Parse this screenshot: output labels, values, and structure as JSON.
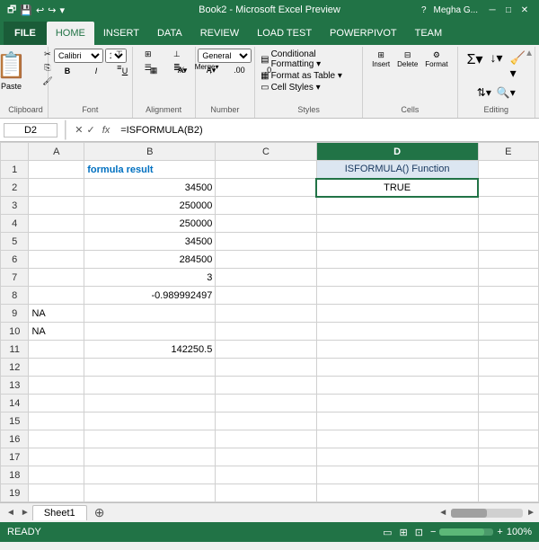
{
  "titleBar": {
    "title": "Book2 - Microsoft Excel Preview",
    "controls": [
      "–",
      "□",
      "×"
    ]
  },
  "ribbonTabs": {
    "file": "FILE",
    "tabs": [
      "HOME",
      "INSERT",
      "DATA",
      "REVIEW",
      "LOAD TEST",
      "POWERPIVOT",
      "TEAM"
    ],
    "activeTab": "HOME",
    "user": "Megha G..."
  },
  "ribbonGroups": {
    "clipboard": {
      "label": "Clipboard",
      "paste": "Paste"
    },
    "font": {
      "label": "Font"
    },
    "alignment": {
      "label": "Alignment"
    },
    "number": {
      "label": "Number"
    },
    "styles": {
      "label": "Styles",
      "items": [
        "Conditional Formatting",
        "Format as Table",
        "Cell Styles"
      ]
    },
    "cells": {
      "label": "Cells"
    },
    "editing": {
      "label": "Editing"
    }
  },
  "formulaBar": {
    "nameBox": "D2",
    "formula": "=ISFORMULA(B2)",
    "fx": "fx"
  },
  "sheet": {
    "columns": [
      "",
      "A",
      "B",
      "C",
      "D",
      "E"
    ],
    "rows": [
      {
        "row": "1",
        "a": "",
        "b": "formula result",
        "c": "",
        "d": "ISFORMULA() Function",
        "e": ""
      },
      {
        "row": "2",
        "a": "",
        "b": "34500",
        "c": "",
        "d": "TRUE",
        "e": ""
      },
      {
        "row": "3",
        "a": "",
        "b": "250000",
        "c": "",
        "d": "",
        "e": ""
      },
      {
        "row": "4",
        "a": "",
        "b": "250000",
        "c": "",
        "d": "",
        "e": ""
      },
      {
        "row": "5",
        "a": "",
        "b": "34500",
        "c": "",
        "d": "",
        "e": ""
      },
      {
        "row": "6",
        "a": "",
        "b": "284500",
        "c": "",
        "d": "",
        "e": ""
      },
      {
        "row": "7",
        "a": "",
        "b": "3",
        "c": "",
        "d": "",
        "e": ""
      },
      {
        "row": "8",
        "a": "",
        "b": "-0.989992497",
        "c": "",
        "d": "",
        "e": ""
      },
      {
        "row": "9",
        "a": "NA",
        "b": "",
        "c": "",
        "d": "",
        "e": ""
      },
      {
        "row": "10",
        "a": "NA",
        "b": "",
        "c": "",
        "d": "",
        "e": ""
      },
      {
        "row": "11",
        "a": "",
        "b": "142250.5",
        "c": "",
        "d": "",
        "e": ""
      },
      {
        "row": "12",
        "a": "",
        "b": "",
        "c": "",
        "d": "",
        "e": ""
      },
      {
        "row": "13",
        "a": "",
        "b": "",
        "c": "",
        "d": "",
        "e": ""
      },
      {
        "row": "14",
        "a": "",
        "b": "",
        "c": "",
        "d": "",
        "e": ""
      },
      {
        "row": "15",
        "a": "",
        "b": "",
        "c": "",
        "d": "",
        "e": ""
      },
      {
        "row": "16",
        "a": "",
        "b": "",
        "c": "",
        "d": "",
        "e": ""
      },
      {
        "row": "17",
        "a": "",
        "b": "",
        "c": "",
        "d": "",
        "e": ""
      },
      {
        "row": "18",
        "a": "",
        "b": "",
        "c": "",
        "d": "",
        "e": ""
      },
      {
        "row": "19",
        "a": "",
        "b": "",
        "c": "",
        "d": "",
        "e": ""
      }
    ]
  },
  "sheetTabs": {
    "tabs": [
      "Sheet1"
    ],
    "addLabel": "⊕"
  },
  "statusBar": {
    "status": "READY",
    "zoom": "100%"
  }
}
